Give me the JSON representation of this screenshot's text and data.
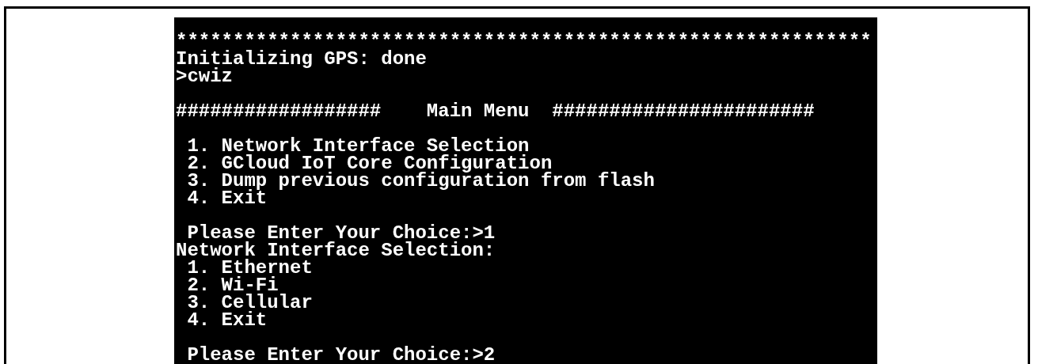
{
  "terminal": {
    "blocks": [
      [
        "*************************************************************",
        "Initializing GPS: done",
        ">cwiz"
      ],
      [
        "##################    Main Menu  #######################"
      ],
      [
        " 1. Network Interface Selection",
        " 2. GCloud IoT Core Configuration",
        " 3. Dump previous configuration from flash",
        " 4. Exit"
      ],
      [
        " Please Enter Your Choice:>1",
        "Network Interface Selection:",
        " 1. Ethernet",
        " 2. Wi-Fi",
        " 3. Cellular",
        " 4. Exit"
      ],
      [
        " Please Enter Your Choice:>2"
      ]
    ]
  }
}
